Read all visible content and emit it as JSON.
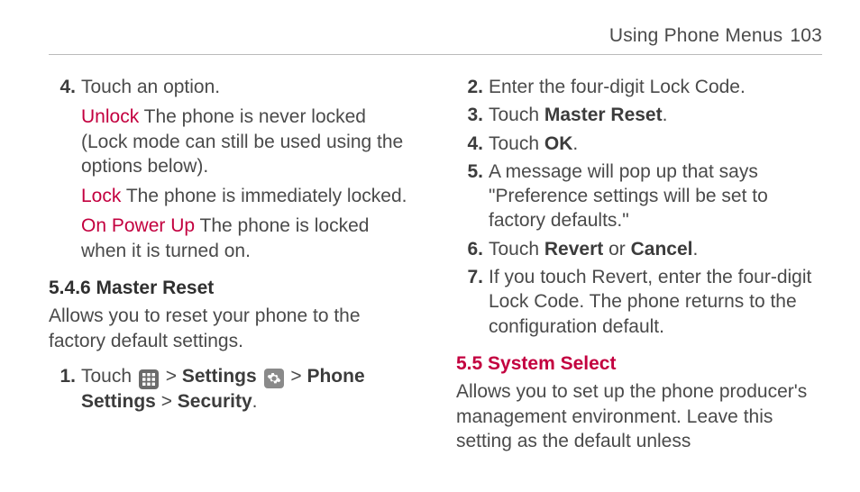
{
  "header": {
    "title": "Using Phone Menus",
    "page": "103"
  },
  "left": {
    "item4": {
      "num": "4.",
      "lead": "Touch an option.",
      "opts": [
        {
          "label": "Unlock",
          "text": " The phone is never locked (Lock mode can still be used using the options below)."
        },
        {
          "label": "Lock",
          "text": " The phone is immediately locked."
        },
        {
          "label": "On Power Up",
          "text": " The phone is locked when it is turned on."
        }
      ]
    },
    "sec546": {
      "num": "5.4.6 ",
      "title": "Master Reset"
    },
    "sec546_desc": "Allows you to reset your phone to the factory default settings.",
    "item1": {
      "num": "1.",
      "touch": "Touch ",
      "gt": " > ",
      "settings": "Settings",
      "phone_settings": "Phone Settings",
      "security": "Security",
      "period": "."
    }
  },
  "right": {
    "items": [
      {
        "num": "2.",
        "pre": "Enter the four-digit Lock Code."
      },
      {
        "num": "3.",
        "pre": "Touch ",
        "bold": "Master Reset",
        "post": "."
      },
      {
        "num": "4.",
        "pre": "Touch ",
        "bold": "OK",
        "post": "."
      },
      {
        "num": "5.",
        "pre": "A message will pop up that says \"Preference settings will be set to factory defaults.\""
      },
      {
        "num": "6.",
        "pre": "Touch ",
        "bold": "Revert",
        "mid": " or ",
        "bold2": "Cancel",
        "post": "."
      },
      {
        "num": "7.",
        "pre": "If you touch Revert, enter the four-digit Lock Code. The phone returns to the configuration default."
      }
    ],
    "sec55": {
      "full": "5.5 System Select"
    },
    "sec55_desc": "Allows you to set up the phone producer's management environment. Leave this setting as the default unless"
  }
}
